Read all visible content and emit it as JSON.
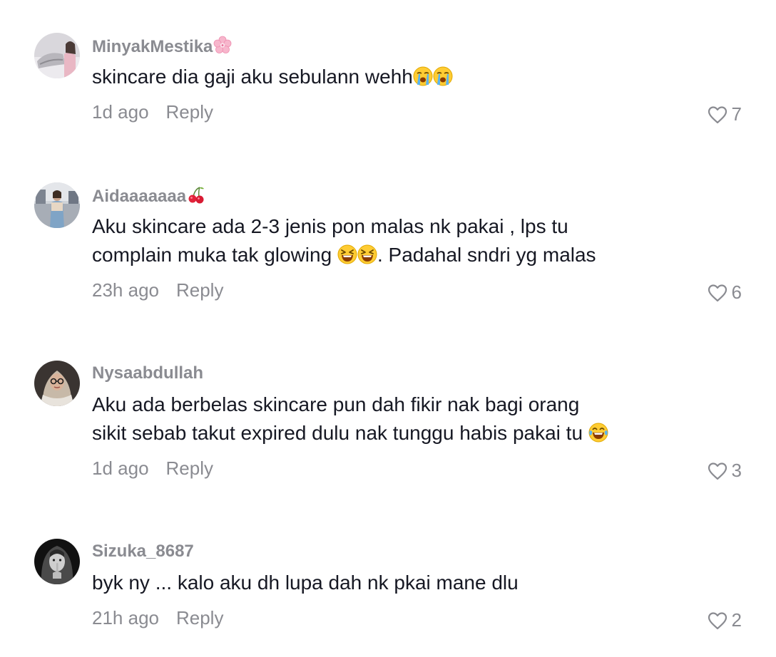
{
  "comments": [
    {
      "username": "MinyakMestika",
      "username_emoji": "cherry-blossom",
      "text_parts": [
        "skincare dia gaji aku sebulann wehh"
      ],
      "text_emojis": [
        "crying-face",
        "crying-face"
      ],
      "time": "1d ago",
      "reply_label": "Reply",
      "likes": "7"
    },
    {
      "username": "Aidaaaaaaa",
      "username_emoji": "cherries",
      "text_line1": "Aku skincare ada 2-3 jenis pon malas nk pakai , lps tu",
      "text_line2_pre": "complain muka tak glowing ",
      "text_line2_post": ". Padahal sndri yg malas",
      "text_emojis": [
        "laughing-squint-face",
        "laughing-squint-face"
      ],
      "time": "23h ago",
      "reply_label": "Reply",
      "likes": "6"
    },
    {
      "username": "Nysaabdullah",
      "text_line1": "Aku ada berbelas skincare pun dah fikir nak bagi orang",
      "text_line2": "sikit sebab takut expired dulu nak tunggu habis pakai tu ",
      "text_emojis": [
        "tears-of-joy-face"
      ],
      "time": "1d ago",
      "reply_label": "Reply",
      "likes": "3"
    },
    {
      "username": "Sizuka_8687",
      "text": "byk ny ... kalo aku dh lupa dah nk pkai mane dlu",
      "time": "21h ago",
      "reply_label": "Reply",
      "likes": "2"
    }
  ],
  "colors": {
    "username": "#8a8b91",
    "text": "#161823",
    "meta": "#8a8b91",
    "background": "#ffffff"
  }
}
